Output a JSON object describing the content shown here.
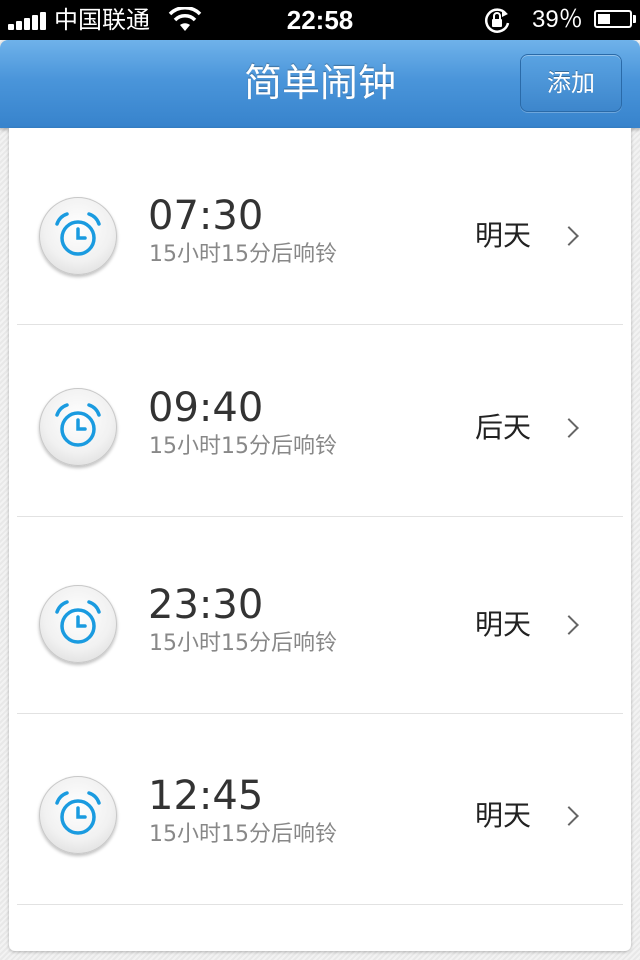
{
  "status_bar": {
    "carrier": "中国联通",
    "time": "22:58",
    "battery_percent": "39％",
    "battery_level": 0.39,
    "icons": [
      "signal-icon",
      "wifi-icon",
      "rotation-lock-icon",
      "battery-icon"
    ]
  },
  "nav": {
    "title": "简单闹钟",
    "add_label": "添加"
  },
  "colors": {
    "accent_blue": "#3c8ad6",
    "alarm_icon_blue": "#1a9be0"
  },
  "alarms": [
    {
      "time": "07:30",
      "subtitle": "15小时15分后响铃",
      "day": "明天"
    },
    {
      "time": "09:40",
      "subtitle": "15小时15分后响铃",
      "day": "后天"
    },
    {
      "time": "23:30",
      "subtitle": "15小时15分后响铃",
      "day": "明天"
    },
    {
      "time": "12:45",
      "subtitle": "15小时15分后响铃",
      "day": "明天"
    }
  ]
}
